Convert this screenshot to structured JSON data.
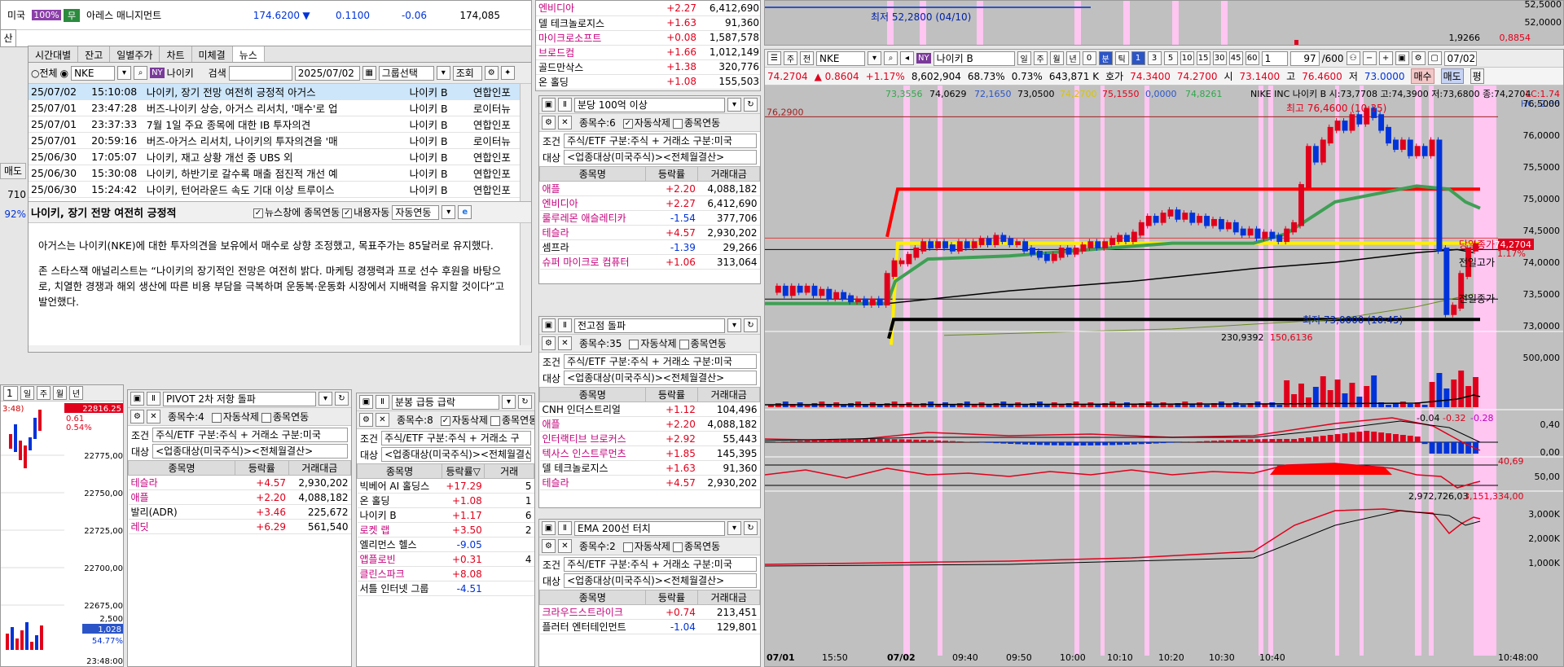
{
  "left_quote": {
    "market": "미국",
    "pct_badge": "100%",
    "tag": "무",
    "name": "아레스 매니지먼트",
    "price": "174.6200",
    "arrow": "▼",
    "diff": "0.1100",
    "rate": "-0.06",
    "volume": "174,085"
  },
  "side_fragments": {
    "a": "산",
    "b": "매도",
    "c": "710",
    "d": "92%"
  },
  "news_tabs": [
    "시간대별",
    "잔고",
    "일별주가",
    "차트",
    "미체결",
    "뉴스"
  ],
  "news_toolbar": {
    "radio_all": "전체",
    "code": "NKE",
    "ny": "NY",
    "stock": "나이키",
    "search_label": "검색",
    "date": "2025/07/02",
    "group": "그룹선택",
    "query": "조회"
  },
  "news_rows": [
    {
      "date": "25/07/02",
      "time": "15:10:08",
      "title": "나이키, 장기 전망 여전히 긍정적  아거스",
      "stock": "나이키 B",
      "src": "연합인포"
    },
    {
      "date": "25/07/01",
      "time": "23:47:28",
      "title": "버즈-나이키 상승, 아거스 리서치, '매수'로 업",
      "stock": "나이키 B",
      "src": "로이터뉴"
    },
    {
      "date": "25/07/01",
      "time": "23:37:33",
      "title": "7월 1일 주요 종목에 대한 IB 투자의견",
      "stock": "나이키 B",
      "src": "연합인포"
    },
    {
      "date": "25/07/01",
      "time": "20:59:16",
      "title": "버즈-아거스 리서치, 나이키의 투자의견을 '매",
      "stock": "나이키 B",
      "src": "로이터뉴"
    },
    {
      "date": "25/06/30",
      "time": "17:05:07",
      "title": "나이키, 재고 상황 개선 중  UBS 외",
      "stock": "나이키 B",
      "src": "연합인포"
    },
    {
      "date": "25/06/30",
      "time": "15:30:08",
      "title": "나이키, 하반기로 갈수록 매출 점진적 개선 예",
      "stock": "나이키 B",
      "src": "연합인포"
    },
    {
      "date": "25/06/30",
      "time": "15:24:42",
      "title": "나이키, 턴어라운드 속도 기대 이상  트루이스",
      "stock": "나이키 B",
      "src": "연합인포"
    }
  ],
  "news_detail": {
    "headline": "나이키, 장기 전망 여전히 긍정적",
    "chk1": "뉴스창에 종목연동",
    "chk2": "내용자동",
    "mode": "자동연동",
    "p1": "아거스는 나이키(NKE)에 대한 투자의견을 보유에서 매수로 상향 조정했고, 목표주가는 85달러로 유지했다.",
    "p2": "존 스타스잭 애널리스트는 “나이키의 장기적인 전망은 여전히 밝다. 마케팅 경쟁력과 프로 선수 후원을 바탕으로, 치열한 경쟁과 해외 생산에 따른 비용 부담을 극복하며 운동복·운동화 시장에서 지배력을 유지할 것이다”고 발언했다."
  },
  "mini_chart": {
    "tf": [
      "1",
      "일",
      "주",
      "월",
      "년"
    ],
    "top": "3:48)",
    "cur": "22816.25",
    "r1": "0.54%",
    "r2": "0.61",
    "ticks": [
      "22775,00",
      "22750,00",
      "22725,00",
      "22700,00",
      "22675,00"
    ],
    "vol": "2,500",
    "vol2": "1,028",
    "pct": "54.77%",
    "time": "23:48:00"
  },
  "top_list": {
    "rows": [
      {
        "name": "엔비디아",
        "rate": "+2.27",
        "amt": "6,412,690",
        "cls": "mag"
      },
      {
        "name": "델 테크놀로지스",
        "rate": "+1.63",
        "amt": "91,360",
        "cls": "blk"
      },
      {
        "name": "마이크로소프트",
        "rate": "+0.08",
        "amt": "1,587,578",
        "cls": "mag"
      },
      {
        "name": "브로드컴",
        "rate": "+1.66",
        "amt": "1,012,149",
        "cls": "mag"
      },
      {
        "name": "골드만삭스",
        "rate": "+1.38",
        "amt": "320,776",
        "cls": "blk"
      },
      {
        "name": "온 홀딩",
        "rate": "+1.08",
        "amt": "155,503",
        "cls": "blk"
      }
    ]
  },
  "screeners": [
    {
      "title": "분당 100억 이상",
      "count": "종목수:6",
      "auto": "자동삭제",
      "link": "종목연동",
      "cond": "주식/ETF 구분:주식 + 거래소 구분:미국",
      "target": "<업종대상(미국주식)><전체월결산>",
      "headers": [
        "종목명",
        "등락률",
        "거래대금"
      ],
      "rows": [
        {
          "name": "애플",
          "rate": "+2.20",
          "amt": "4,088,182",
          "cls": "mag"
        },
        {
          "name": "엔비디아",
          "rate": "+2.27",
          "amt": "6,412,690",
          "cls": "mag"
        },
        {
          "name": "룰루레몬 애슬레티카",
          "rate": "-1.54",
          "amt": "377,706",
          "cls": "mag"
        },
        {
          "name": "테슬라",
          "rate": "+4.57",
          "amt": "2,930,202",
          "cls": "mag"
        },
        {
          "name": "셈프라",
          "rate": "-1.39",
          "amt": "29,266",
          "cls": "blk"
        },
        {
          "name": "슈퍼 마이크로 컴퓨터",
          "rate": "+1.06",
          "amt": "313,064",
          "cls": "mag"
        }
      ]
    },
    {
      "title": "전고점 돌파",
      "count": "종목수:35",
      "auto": "자동삭제",
      "link": "종목연동",
      "cond": "주식/ETF 구분:주식 + 거래소 구분:미국",
      "target": "<업종대상(미국주식)><전체월결산>",
      "headers": [
        "종목명",
        "등락률",
        "거래대금"
      ],
      "rows": [
        {
          "name": "CNH 인더스트리얼",
          "rate": "+1.12",
          "amt": "104,496",
          "cls": "blk"
        },
        {
          "name": "애플",
          "rate": "+2.20",
          "amt": "4,088,182",
          "cls": "mag"
        },
        {
          "name": "인터랙티브 브로커스",
          "rate": "+2.92",
          "amt": "55,443",
          "cls": "mag"
        },
        {
          "name": "텍사스 인스트루먼츠",
          "rate": "+1.85",
          "amt": "145,395",
          "cls": "mag"
        },
        {
          "name": "델 테크놀로지스",
          "rate": "+1.63",
          "amt": "91,360",
          "cls": "blk"
        },
        {
          "name": "테슬라",
          "rate": "+4.57",
          "amt": "2,930,202",
          "cls": "mag"
        }
      ]
    },
    {
      "title": "EMA 200선 터치",
      "count": "종목수:2",
      "auto": "자동삭제",
      "link": "종목연동",
      "cond": "주식/ETF 구분:주식 + 거래소 구분:미국",
      "target": "<업종대상(미국주식)><전체월결산>",
      "headers": [
        "종목명",
        "등락률",
        "거래대금"
      ],
      "rows": [
        {
          "name": "크라우드스트라이크",
          "rate": "+0.74",
          "amt": "213,451",
          "cls": "mag"
        },
        {
          "name": "플러터 엔터테인먼트",
          "rate": "-1.04",
          "amt": "129,801",
          "cls": "blk"
        }
      ]
    },
    {
      "title": "PIVOT 2차 저항 돌파",
      "count": "종목수:4",
      "auto": "자동삭제",
      "link": "종목연동",
      "cond": "주식/ETF 구분:주식 + 거래소 구분:미국",
      "target": "<업종대상(미국주식)><전체월결산>",
      "headers": [
        "종목명",
        "등락률",
        "거래대금"
      ],
      "rows": [
        {
          "name": "테슬라",
          "rate": "+4.57",
          "amt": "2,930,202",
          "cls": "mag"
        },
        {
          "name": "애플",
          "rate": "+2.20",
          "amt": "4,088,182",
          "cls": "mag"
        },
        {
          "name": "발리(ADR)",
          "rate": "+3.46",
          "amt": "225,672",
          "cls": "blk"
        },
        {
          "name": "레딧",
          "rate": "+6.29",
          "amt": "561,540",
          "cls": "mag"
        }
      ]
    },
    {
      "title": "분봉 급등 급락",
      "count": "종목수:8",
      "auto": "자동삭제",
      "link": "종목연동",
      "cond": "주식/ETF 구분:주식 + 거래소 구",
      "target": "<업종대상(미국주식)><전체월결산",
      "headers": [
        "종목명",
        "등락률▽",
        "거래"
      ],
      "rows": [
        {
          "name": "빅베어 AI 홀딩스",
          "rate": "+17.29",
          "amt": "5",
          "cls": "blk"
        },
        {
          "name": "온 홀딩",
          "rate": "+1.08",
          "amt": "1",
          "cls": "blk"
        },
        {
          "name": "나이키 B",
          "rate": "+1.17",
          "amt": "6",
          "cls": "blk"
        },
        {
          "name": "로켓 랩",
          "rate": "+3.50",
          "amt": "2",
          "cls": "mag"
        },
        {
          "name": "엘리먼스 헬스",
          "rate": "-9.05",
          "amt": "",
          "cls": "blk"
        },
        {
          "name": "앱플로빈",
          "rate": "+0.31",
          "amt": "4",
          "cls": "mag"
        },
        {
          "name": "클린스파크",
          "rate": "+8.08",
          "amt": "",
          "cls": "mag"
        },
        {
          "name": "서틀 인터넷 그룹",
          "rate": "-4.51",
          "amt": "",
          "cls": "blk"
        }
      ]
    }
  ],
  "chart_header": {
    "menu": "주",
    "prev": "전",
    "code": "NKE",
    "ny": "NY",
    "name": "나이키 B",
    "periods": [
      "일",
      "주",
      "월",
      "년",
      "0",
      "분",
      "틱"
    ],
    "mins": [
      "1",
      "3",
      "5",
      "10",
      "15",
      "30",
      "45",
      "60"
    ],
    "cnt": "1",
    "bars": "97",
    "max": "/600",
    "date": "07/02"
  },
  "quote_strip": {
    "price": "74.2704",
    "chg": "▲ 0.8604",
    "rate": "+1.17%",
    "vol": "8,602,904",
    "v2": "68.73%",
    "v3": "0.73%",
    "amt": "643,871 K",
    "ask_lbl": "호가",
    "ask": "74.3400",
    "bid": "74.2700",
    "o_lbl": "시",
    "o": "73.1400",
    "h_lbl": "고",
    "h": "76.4600",
    "l_lbl": "저",
    "l": "73.0000",
    "sell": "매수",
    "buy": "매도",
    "pl": "평"
  },
  "ma_legend": {
    "m1": "73,3556",
    "m2": "74,0629",
    "m3": "72,1650",
    "m4": "73,0500",
    "m5": "74,2700",
    "m6": "75,1550",
    "m7": "0,0000",
    "m8": "74,8261",
    "title": "NIKE INC 나이키 B 시:73,7708 고:74,3900 저:73,6800 종:74,2704",
    "lc": "LC:1.74",
    "hc": "HC:-2.86"
  },
  "top_chart": {
    "low_label": "최저 52,2800 (04/10)",
    "y1": "52,5000",
    "y2": "52,0000",
    "v1": "1,9266",
    "v2": "0,8854"
  },
  "labels": {
    "ref_left": "76,2900",
    "high": "최고 76,4600 (10:35)",
    "low": "최저 73,0000 (10:45)",
    "today_up": "당일종가",
    "prev_high": "전일고가",
    "prev_close": "전일종가",
    "cur": "74,2704",
    "cur_pct": "1.17%",
    "vol_top": "230,9392",
    "vol_top2": "150,6136",
    "macd": "-0.04",
    "macd2": "-0.32",
    "macd3": "-0.28",
    "rsi": "40,69",
    "obv": "2,972,726,03",
    "obv2": "3,151,334,00"
  },
  "price_axis": [
    "76,5000",
    "76,0000",
    "75,5000",
    "75,0000",
    "74,5000",
    "74,0000",
    "73,5000",
    "73,0000"
  ],
  "vol_axis": [
    "500,000",
    "0"
  ],
  "macd_axis": [
    "0,40",
    "0,00",
    "-0,40"
  ],
  "rsi_axis": [
    "50,00"
  ],
  "obv_axis": [
    "3,000K",
    "2,000K",
    "1,000K"
  ],
  "time_axis": [
    "07/01",
    "15:50",
    "07/02",
    "09:40",
    "09:50",
    "10:00",
    "10:10",
    "10:20",
    "10:30",
    "10:40",
    "10:48:00"
  ],
  "colors": {
    "up": "#e1001b",
    "down": "#0033d9",
    "pink": "#ffc6f2",
    "yellow": "#ffee00",
    "green": "#3f9f55"
  }
}
